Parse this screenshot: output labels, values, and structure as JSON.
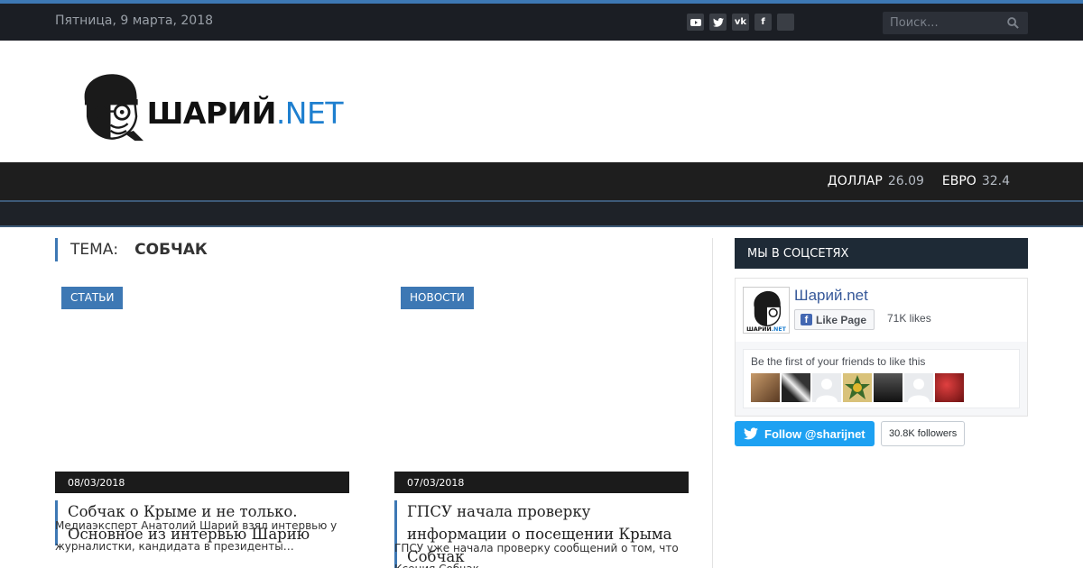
{
  "topbar": {
    "date": "Пятница, 9 марта, 2018",
    "social_icons": [
      "youtube-icon",
      "twitter-icon",
      "vk-icon",
      "facebook-icon",
      "blank-icon"
    ],
    "search_placeholder": "Поиск..."
  },
  "logo": {
    "word": "ШАРИЙ",
    "suffix": ".NET"
  },
  "rates": [
    {
      "label": "ДОЛЛАР",
      "value": "26.09"
    },
    {
      "label": "ЕВРО",
      "value": "32.4"
    }
  ],
  "topic": {
    "label": "ТЕМА:",
    "name": "СОБЧАК"
  },
  "articles": [
    {
      "category": "СТАТЬИ",
      "date": "08/03/2018",
      "title": "Собчак о Крыме и не только. Основное из интервью Шарию",
      "excerpt": "Медиаэксперт Анатолий Шарий взял интервью у журналистки, кандидата в президенты…"
    },
    {
      "category": "НОВОСТИ",
      "date": "07/03/2018",
      "title": "ГПСУ начала проверку информации о посещении Крыма Собчак",
      "excerpt": "ГПСУ уже начала проверку сообщений о том, что Ксения Собчак"
    }
  ],
  "sidebar": {
    "heading": "МЫ В СОЦСЕТЯХ",
    "fb": {
      "page_name": "Шарий.net",
      "like_label": "Like Page",
      "likes": "71K likes",
      "friends_text": "Be the first of your friends to like this"
    },
    "twitter": {
      "follow_label": "Follow @sharijnet",
      "followers": "30.8K followers"
    }
  },
  "colors": {
    "accent": "#3d78b4",
    "topbar": "#1b1e24",
    "twitter": "#1da1f2",
    "facebook": "#4267b2"
  }
}
